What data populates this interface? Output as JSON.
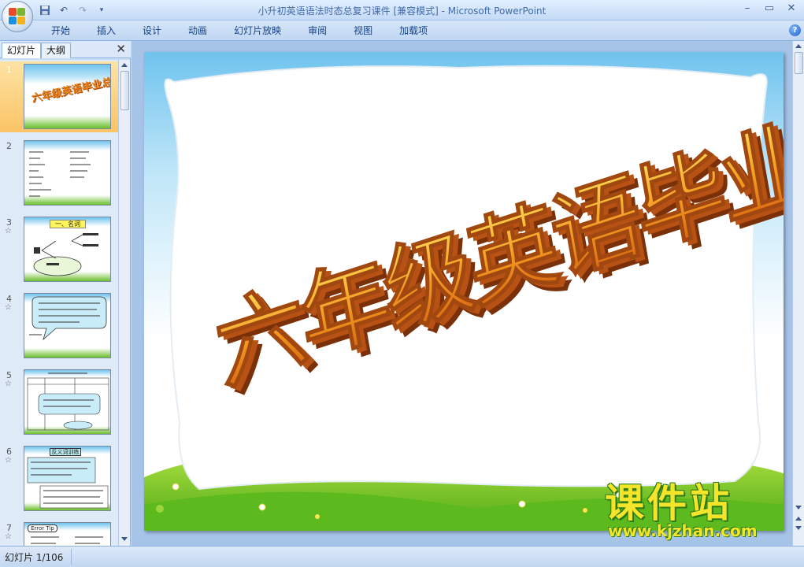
{
  "window": {
    "title": "小升初英语语法时态总复习课件 [兼容模式] - Microsoft PowerPoint",
    "controls": [
      "–",
      "▭",
      "✕"
    ]
  },
  "quick_access": [
    "save-icon",
    "undo-icon",
    "redo-icon",
    "customize-icon"
  ],
  "ribbon": {
    "tabs": [
      "开始",
      "插入",
      "设计",
      "动画",
      "幻灯片放映",
      "审阅",
      "视图",
      "加载项"
    ],
    "help": "?"
  },
  "pane": {
    "tabs": [
      "幻灯片",
      "大纲"
    ],
    "close": "✕",
    "thumbnails": [
      {
        "num": "1",
        "star": "",
        "label": "六年级英语毕业总复习",
        "selected": true
      },
      {
        "num": "2",
        "star": "",
        "label": ""
      },
      {
        "num": "3",
        "star": "☆",
        "label": "一、名词"
      },
      {
        "num": "4",
        "star": "☆",
        "label": ""
      },
      {
        "num": "5",
        "star": "☆",
        "label": ""
      },
      {
        "num": "6",
        "star": "☆",
        "label": "反义词训练"
      },
      {
        "num": "7",
        "star": "☆",
        "label": "Error Tip"
      }
    ]
  },
  "slide": {
    "title": "六年级英语毕业总复习",
    "colors": {
      "sky": "#6fc3ee",
      "grass": "#6abf2a",
      "title_front": "#e8821a",
      "title_side": "#a04810",
      "frame": "#ffffff"
    }
  },
  "status": {
    "slide_info": "幻灯片 1/106"
  },
  "watermark": {
    "cn": "课件站",
    "url": "www.kjzhan.com"
  }
}
